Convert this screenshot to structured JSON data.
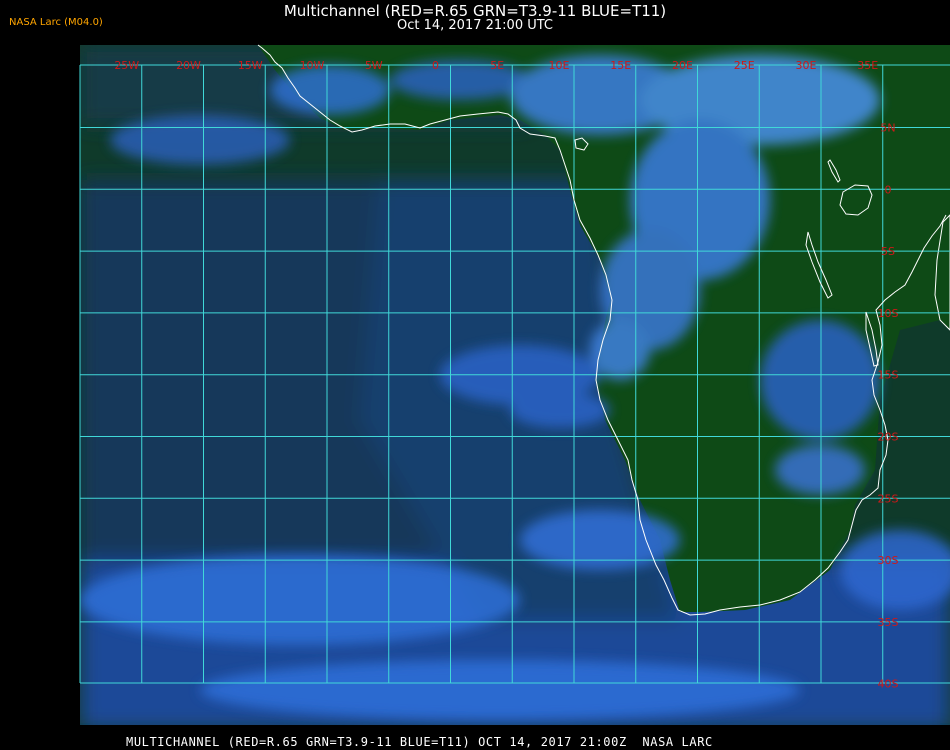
{
  "header": {
    "title": "Multichannel (RED=R.65 GRN=T3.9-11 BLUE=T11)",
    "datetime": "Oct 14, 2017 21:00 UTC",
    "version": "NASA Larc (M04.0)"
  },
  "footer": {
    "caption": "MULTICHANNEL (RED=R.65 GRN=T3.9-11 BLUE=T11) OCT 14, 2017 21:00Z  NASA LARC"
  },
  "map": {
    "longitude_labels": [
      "25W",
      "20W",
      "15W",
      "10W",
      "5W",
      "0",
      "5E",
      "10E",
      "15E",
      "20E",
      "25E",
      "30E",
      "35E"
    ],
    "latitude_labels": [
      "5N",
      "0",
      "5S",
      "10S",
      "15S",
      "20S",
      "25S",
      "30S",
      "35S",
      "40S"
    ],
    "colors": {
      "grid": "#40d8d8",
      "label": "#d01818",
      "coast": "#ffffff",
      "land": "#0d4a16",
      "ocean": "#123a5a",
      "cloud": "#2e6fd8"
    }
  }
}
